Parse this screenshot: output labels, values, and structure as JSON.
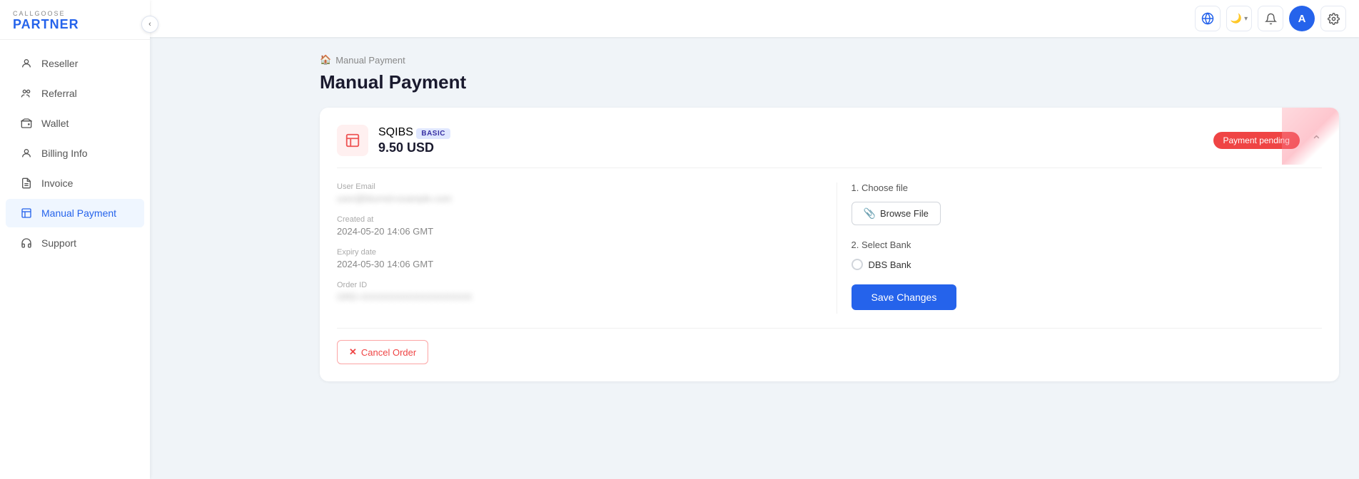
{
  "app": {
    "brand_small": "CALLGOOSE",
    "brand_large": "PARTNER"
  },
  "sidebar": {
    "items": [
      {
        "id": "reseller",
        "label": "Reseller",
        "icon": "👤",
        "active": false
      },
      {
        "id": "referral",
        "label": "Referral",
        "icon": "👥",
        "active": false
      },
      {
        "id": "wallet",
        "label": "Wallet",
        "icon": "💳",
        "active": false
      },
      {
        "id": "billing-info",
        "label": "Billing Info",
        "icon": "👤",
        "active": false
      },
      {
        "id": "invoice",
        "label": "Invoice",
        "icon": "📄",
        "active": false
      },
      {
        "id": "manual-payment",
        "label": "Manual Payment",
        "icon": "🏠",
        "active": true
      },
      {
        "id": "support",
        "label": "Support",
        "icon": "🎧",
        "active": false
      }
    ]
  },
  "topbar": {
    "lang_icon": "A",
    "theme_label": "🌙",
    "notification_icon": "🔔",
    "avatar_initial": "A",
    "settings_icon": "⚙"
  },
  "breadcrumb": {
    "icon": "🏠",
    "label": "Manual Payment"
  },
  "page": {
    "title": "Manual Payment"
  },
  "card": {
    "service_name": "SQIBS",
    "service_badge": "BASIC",
    "service_amount": "9.50 USD",
    "status_badge": "Payment pending",
    "fields": {
      "user_email_label": "User Email",
      "user_email_value": "user@example.com",
      "created_at_label": "Created at",
      "created_at_value": "2024-05-20 14:06 GMT",
      "expiry_date_label": "Expiry date",
      "expiry_date_value": "2024-05-30 14:06 GMT",
      "order_id_label": "Order ID",
      "order_id_value": "ORD-XXXXXXXXXX"
    },
    "right": {
      "choose_file_label": "1. Choose file",
      "browse_btn_label": "Browse File",
      "select_bank_label": "2. Select Bank",
      "bank_name": "DBS Bank",
      "save_btn_label": "Save Changes"
    },
    "cancel_btn_label": "Cancel Order"
  }
}
